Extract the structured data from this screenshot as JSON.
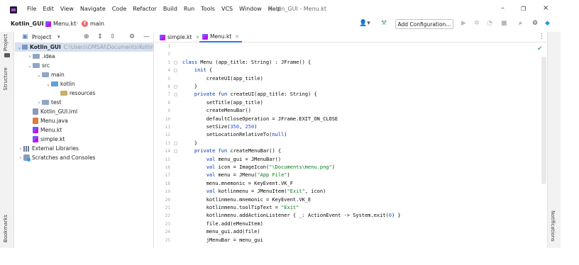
{
  "menubar": {
    "items": [
      "File",
      "Edit",
      "View",
      "Navigate",
      "Code",
      "Refactor",
      "Build",
      "Run",
      "Tools",
      "VCS",
      "Window",
      "Help"
    ],
    "window_title": "Kotlin_GUI - Menu.kt",
    "controls": {
      "minimize": "–",
      "maximize": "❐",
      "close": "×"
    }
  },
  "navbar": {
    "project": "Kotlin_GUI",
    "file": "Menu.kt",
    "function": "main",
    "add_configuration": "Add Configuration..."
  },
  "left_stripe": {
    "tabs": [
      "Project",
      "Structure",
      "Bookmarks"
    ]
  },
  "right_stripe": {
    "tabs": [
      "Notifications"
    ]
  },
  "project_panel": {
    "title": "Project",
    "tree": [
      {
        "label": "Kotlin_GUI",
        "path": "C:\\Users\\OMSAI\\Documents\\Kotlin",
        "icon": "folder-module-icon",
        "level": 0,
        "expanded": true,
        "selected": true
      },
      {
        "label": ".idea",
        "icon": "folder-icon",
        "level": 1,
        "expanded": false
      },
      {
        "label": "src",
        "icon": "folder-icon",
        "level": 1,
        "expanded": true
      },
      {
        "label": "main",
        "icon": "folder-icon",
        "level": 2,
        "expanded": true
      },
      {
        "label": "kotlin",
        "icon": "source-folder-icon",
        "level": 3,
        "expanded": true
      },
      {
        "label": "resources",
        "icon": "resources-folder-icon",
        "level": 4
      },
      {
        "label": "test",
        "icon": "folder-icon",
        "level": 2,
        "expanded": false
      },
      {
        "label": "Kotlin_GUI.iml",
        "icon": "iml-file-icon",
        "level": 1
      },
      {
        "label": "Menu.java",
        "icon": "java-file-icon",
        "level": 1
      },
      {
        "label": "Menu.kt",
        "icon": "kotlin-file-icon",
        "level": 1
      },
      {
        "label": "simple.kt",
        "icon": "kotlin-file-icon",
        "level": 1
      },
      {
        "label": "External Libraries",
        "icon": "libraries-icon",
        "level": 0,
        "expanded": false
      },
      {
        "label": "Scratches and Consoles",
        "icon": "scratches-icon",
        "level": 0,
        "expanded": false
      }
    ]
  },
  "editor": {
    "tabs": [
      {
        "label": "simple.kt",
        "active": false
      },
      {
        "label": "Menu.kt",
        "active": true
      }
    ],
    "line_numbers": [
      "1",
      "2",
      "3",
      "4",
      "5",
      "6",
      "7",
      "8",
      "9",
      "10",
      "11",
      "12",
      "13",
      "14",
      "15",
      "16",
      "17",
      "18",
      "19",
      "20",
      "21",
      "22",
      "23",
      "24",
      "25"
    ],
    "lines": [
      "",
      "",
      "class Menu (app_title: String) : JFrame() {",
      "    init {",
      "        createUI(app_title)",
      "    }",
      "    private fun createUI(app_title: String) {",
      "        setTitle(app_title)",
      "        createMenuBar()",
      "        defaultCloseOperation = JFrame.EXIT_ON_CLOSE",
      "        setSize(350, 250)",
      "        setLocationRelativeTo(null)",
      "    }",
      "    private fun createMenuBar() {",
      "        val menu_gui = JMenuBar()",
      "        val icon = ImageIcon(\"\\Documents\\menu.png\")",
      "        val menu = JMenu(\"App File\")",
      "        menu.mnemonic = KeyEvent.VK_F",
      "        val kotlinmenu = JMenuItem(\"Exit\", icon)",
      "        kotlinmenu.mnemonic = KeyEvent.VK_E",
      "        kotlinmenu.toolTipText = \"Exit\"",
      "        kotlinmenu.addActionListener { _: ActionEvent -> System.exit(0) }",
      "        file.add(eMenuItem)",
      "        menu_gui.add(file)",
      "        jMenuBar = menu_gui"
    ]
  },
  "colors": {
    "keyword": "#0033b3",
    "string": "#067d17",
    "number": "#1750eb",
    "selection": "#d5e1f2",
    "accent": "#3574f0"
  }
}
